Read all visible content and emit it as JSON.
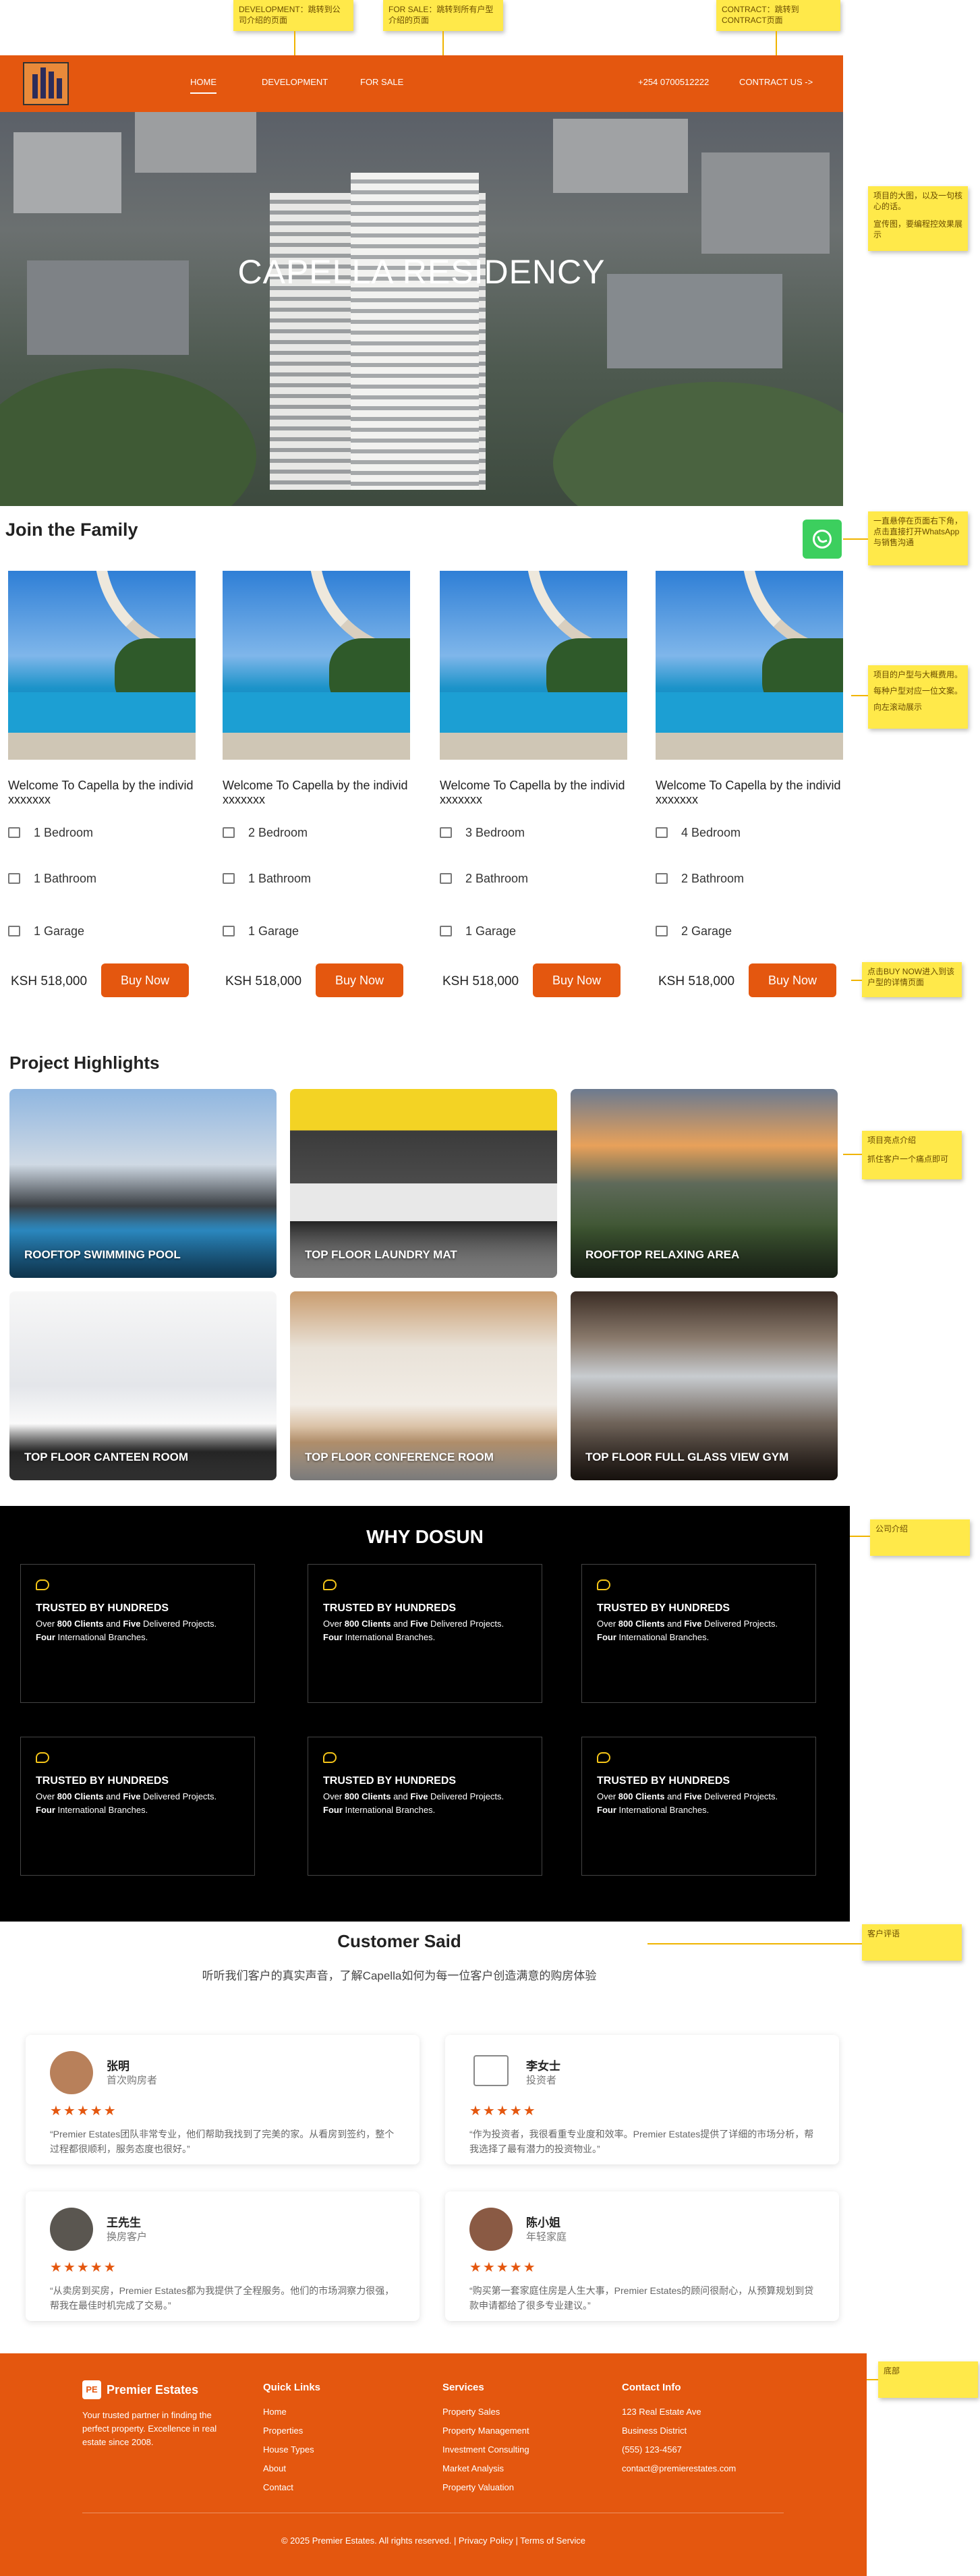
{
  "notes": {
    "development": "DEVELOPMENT：跳转到公司介绍的页面",
    "for_sale": "FOR SALE：跳转到所有户型介绍的页面",
    "contract": "CONTRACT：跳转到CONTRACT页面",
    "hero": "项目的大图，以及一句核心的话。",
    "hero2": "宣传图，要编程控效果展示",
    "whatsapp": "一直悬停在页面右下角，点击直接打开WhatsApp与销售沟通",
    "units": "项目的户型与大概费用。",
    "units2": "每种户型对应一位文案。",
    "units3": "向左滚动展示",
    "buy_now": "点击BUY NOW进入到该户型的详情页面",
    "highlights": "项目亮点介绍",
    "highlights2": "抓住客户一个痛点即可",
    "company": "公司介绍",
    "reviews": "客户评语",
    "footer": "底部"
  },
  "header": {
    "nav": [
      "HOME",
      "DEVELOPMENT",
      "FOR SALE"
    ],
    "phone": "+254 0700512222",
    "contact": "CONTRACT US ->"
  },
  "hero": {
    "title": "CAPELLA RESIDENCY"
  },
  "join": {
    "title": "Join the Family",
    "cards": [
      {
        "title": "Welcome To Capella by the individ xxxxxxx",
        "bedrooms": "1 Bedroom",
        "bathrooms": "1 Bathroom",
        "garage": "1 Garage",
        "price": "KSH 518,000",
        "buy": "Buy Now"
      },
      {
        "title": "Welcome To Capella by the individ xxxxxxx",
        "bedrooms": "2 Bedroom",
        "bathrooms": "1 Bathroom",
        "garage": "1 Garage",
        "price": "KSH 518,000",
        "buy": "Buy Now"
      },
      {
        "title": "Welcome To Capella by the individ xxxxxxx",
        "bedrooms": "3 Bedroom",
        "bathrooms": "2 Bathroom",
        "garage": "1 Garage",
        "price": "KSH 518,000",
        "buy": "Buy Now"
      },
      {
        "title": "Welcome To Capella by the individ xxxxxxx",
        "bedrooms": "4 Bedroom",
        "bathrooms": "2 Bathroom",
        "garage": "2 Garage",
        "price": "KSH 518,000",
        "buy": "Buy Now"
      }
    ]
  },
  "highlights": {
    "title": "Project Highlights",
    "items": [
      "ROOFTOP SWIMMING POOL",
      "TOP FLOOR LAUNDRY MAT",
      "ROOFTOP RELAXING AREA",
      "TOP FLOOR CANTEEN ROOM",
      "TOP FLOOR CONFERENCE ROOM",
      "TOP FLOOR FULL GLASS VIEW GYM"
    ]
  },
  "why": {
    "title": "WHY DOSUN",
    "box_heading": "TRUSTED BY HUNDREDS",
    "box_text": {
      "over": "Over",
      "clients": "800 Clients",
      "and": "and",
      "five": "Five",
      "delivered": "Delivered Projects.",
      "four": "Four",
      "branches": "International Branches."
    }
  },
  "testimonials": {
    "title": "Customer Said",
    "subtitle": "听听我们客户的真实声音，了解Capella如何为每一位客户创造满意的购房体验",
    "stars": "★★★★★",
    "items": [
      {
        "name": "张明",
        "role": "首次购房者",
        "quote": "“Premier Estates团队非常专业，他们帮助我找到了完美的家。从看房到签约，整个过程都很顺利，服务态度也很好。”"
      },
      {
        "name": "李女士",
        "role": "投资者",
        "quote": "“作为投资者，我很看重专业度和效率。Premier Estates提供了详细的市场分析，帮我选择了最有潜力的投资物业。”"
      },
      {
        "name": "王先生",
        "role": "换房客户",
        "quote": "“从卖房到买房，Premier Estates都为我提供了全程服务。他们的市场洞察力很强，帮我在最佳时机完成了交易。”"
      },
      {
        "name": "陈小姐",
        "role": "年轻家庭",
        "quote": "“购买第一套家庭住房是人生大事，Premier Estates的顾问很耐心，从预算规划到贷款申请都给了很多专业建议。”"
      }
    ]
  },
  "footer": {
    "brand_icon": "PE",
    "brand": "Premier Estates",
    "desc": "Your trusted partner in finding the perfect property. Excellence in real estate since 2008.",
    "quick_links": {
      "title": "Quick Links",
      "items": [
        "Home",
        "Properties",
        "House Types",
        "About",
        "Contact"
      ]
    },
    "services": {
      "title": "Services",
      "items": [
        "Property Sales",
        "Property Management",
        "Investment Consulting",
        "Market Analysis",
        "Property Valuation"
      ]
    },
    "contact": {
      "title": "Contact Info",
      "items": [
        "123 Real Estate Ave",
        "Business District",
        "(555) 123-4567",
        "contact@premierestates.com"
      ]
    },
    "copyright": "© 2025 Premier Estates. All rights reserved. | Privacy Policy | Terms of Service"
  },
  "colors": {
    "brand": "#e4570f",
    "whatsapp": "#3ccf5e",
    "note": "#ffe94a"
  }
}
